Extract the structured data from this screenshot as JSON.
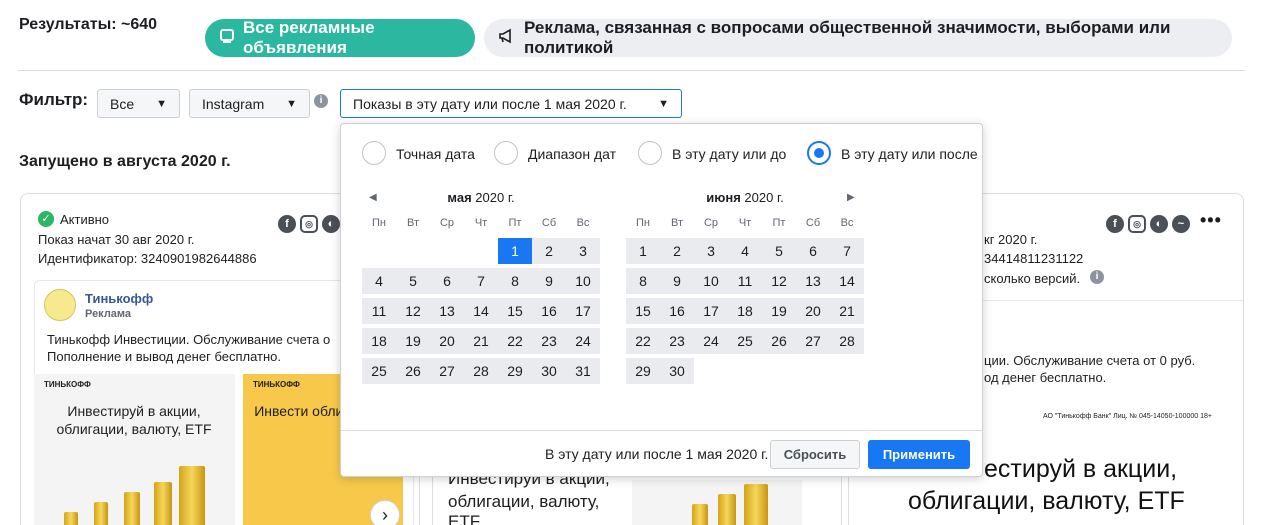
{
  "results_label": "Результаты: ~640",
  "tabs": [
    {
      "label": "Все рекламные объявления",
      "icon": "ad-card-icon"
    },
    {
      "label": "Реклама, связанная с вопросами общественной значимости, выборами или политикой",
      "icon": "megaphone-icon"
    }
  ],
  "filter": {
    "label": "Фильтр:",
    "type_value": "Все",
    "platform_value": "Instagram",
    "date_value": "Показы в эту дату или после 1 мая 2020 г."
  },
  "launched_label": "Запущено в августа 2020 г.",
  "card_left": {
    "status": "Активно",
    "shown_since": "Показ начат 30 авг 2020 г.",
    "id_text": "Идентификатор: 3240901982644886",
    "brand": "Тинькофф",
    "sponsored": "Реклама",
    "text_line1": "Тинькофф Инвестиции. Обслуживание счета о",
    "text_line2": "Пополнение и вывод денег бесплатно.",
    "img1_logo": "ТИНЬКОФФ",
    "img1_head": "Инвестируй в акции, облигации, валюту, ETF",
    "img2_logo": "ТИНЬКОФФ",
    "img2_head": "Инвести облигаци"
  },
  "card_right": {
    "shown_since_part": "кг 2020 г.",
    "id_part": "34414811231122",
    "versions_part": "сколько версий.",
    "text_line1": "ции. Обслуживание счета от 0 руб.",
    "text_line2": "од денег бесплатно.",
    "license": "АО \"Тинькофф Банк\" Лиц. № 045-14050-100000  18+",
    "head_line1": "естируй в акции,",
    "head_line2": "облигации, валюту, ETF"
  },
  "card_mid": {
    "head_line1": "Инвестируй в акции,",
    "head_line2": "облигации, валюту,",
    "head_line3": "ETF"
  },
  "date_picker": {
    "options": [
      {
        "label": "Точная дата",
        "selected": false
      },
      {
        "label": "Диапазон дат",
        "selected": false
      },
      {
        "label": "В эту дату или до",
        "selected": false
      },
      {
        "label": "В эту дату или после",
        "selected": true
      }
    ],
    "weekdays": [
      "Пн",
      "Вт",
      "Ср",
      "Чт",
      "Пт",
      "Сб",
      "Вс"
    ],
    "month1": {
      "name": "мая",
      "year": "2020 г.",
      "offset": 4,
      "days": 31,
      "selected_day": 1
    },
    "month2": {
      "name": "июня",
      "year": "2020 г.",
      "offset": 0,
      "days": 30
    },
    "footer_text": "В эту дату или после 1 мая 2020 г.",
    "reset_label": "Сбросить",
    "apply_label": "Применить"
  },
  "colors": {
    "accent_teal": "#2bb7a0",
    "primary_blue": "#1877f2",
    "status_green": "#2bb764"
  }
}
